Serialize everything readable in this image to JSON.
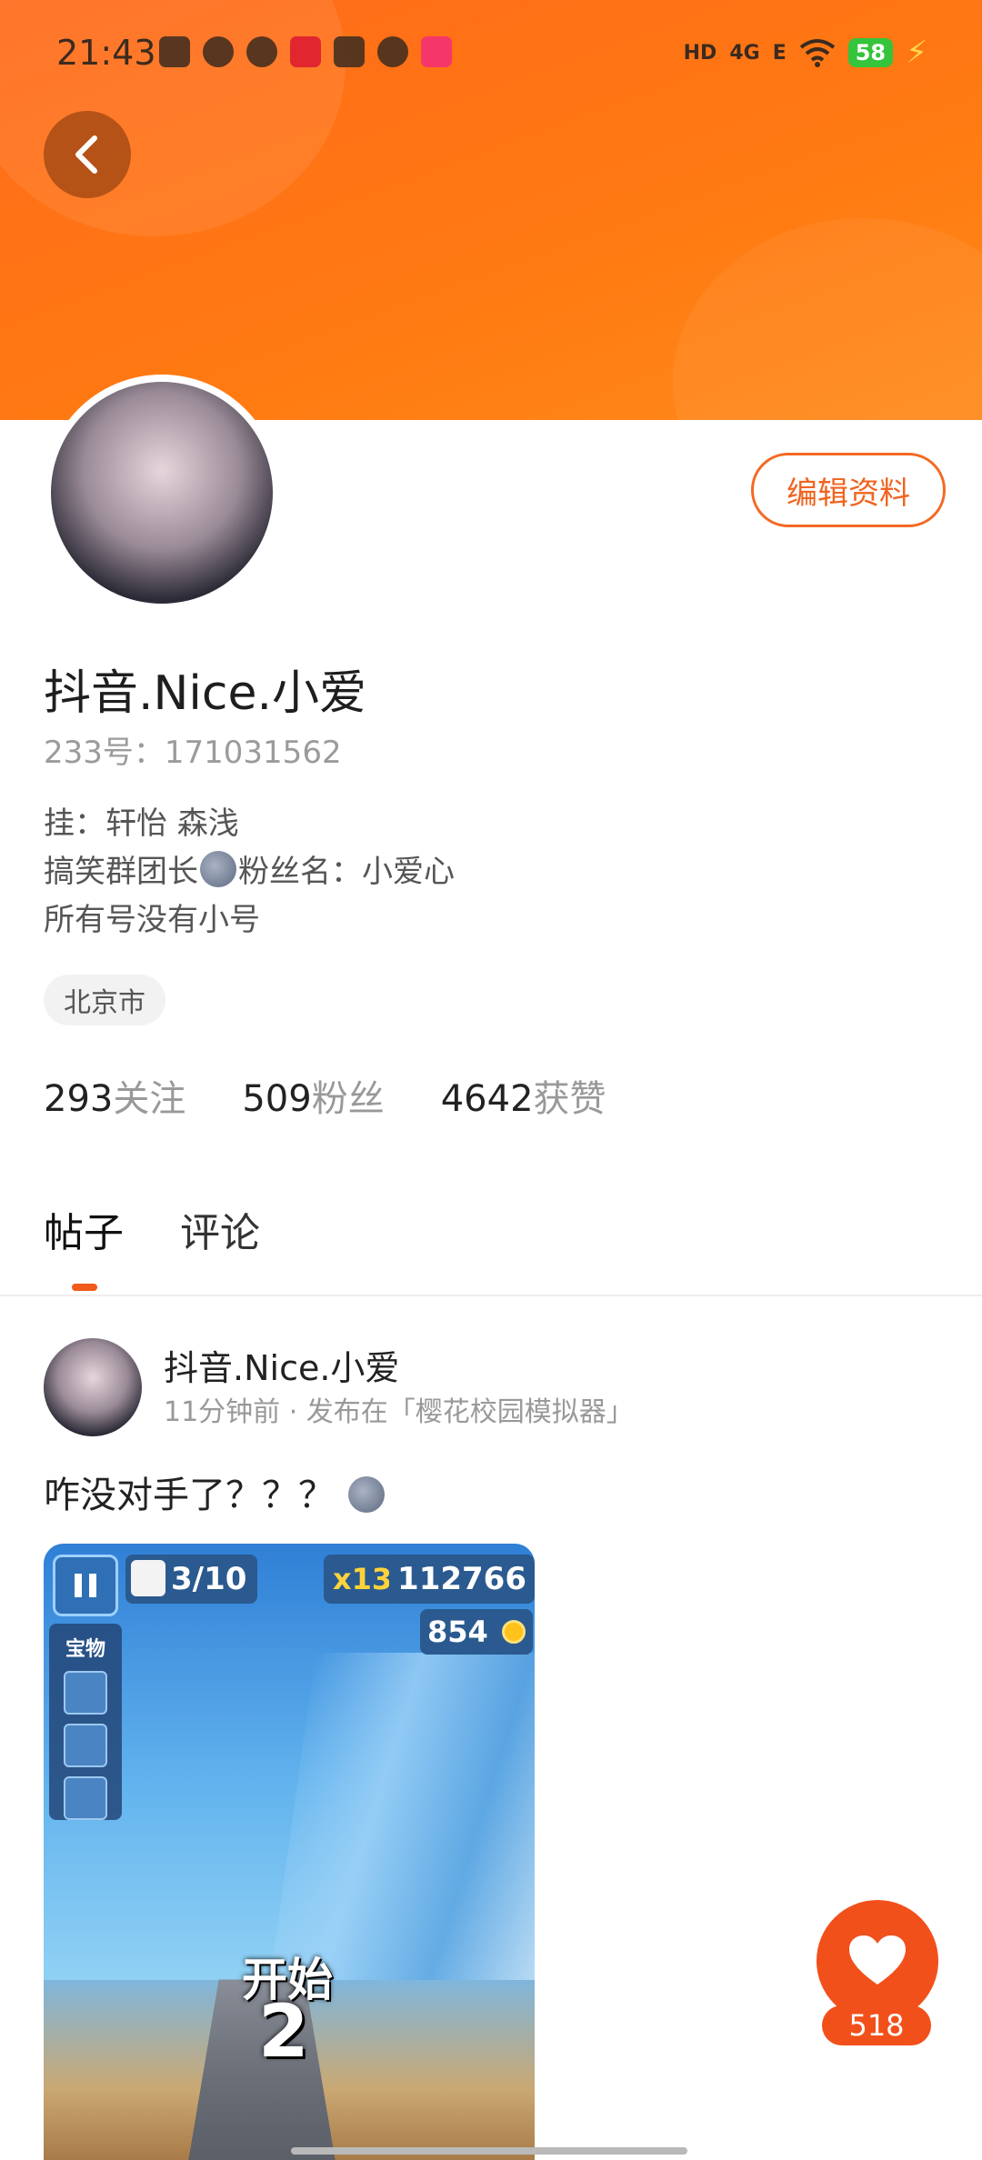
{
  "status_bar": {
    "time": "21:43",
    "network": "HD",
    "signal_4g": "4G",
    "signal_e": "E",
    "battery": "58"
  },
  "profile": {
    "name": "抖音.Nice.小爱",
    "id_text": "233号：171031562",
    "edit_label": "编辑资料",
    "bio_line1": "挂：轩怡 森浅",
    "bio_line2_a": "搞笑群团长",
    "bio_line2_b": "粉丝名：小爱心",
    "bio_line3": "所有号没有小号",
    "location": "北京市",
    "stats": {
      "following_count": "293",
      "following_label": "关注",
      "fans_count": "509",
      "fans_label": "粉丝",
      "likes_count": "4642",
      "likes_label": "获赞"
    }
  },
  "tabs": {
    "posts": "帖子",
    "comments": "评论"
  },
  "post": {
    "author": "抖音.Nice.小爱",
    "meta": "11分钟前 · 发布在「樱花校园模拟器」",
    "text": "咋没对手了？？？",
    "game": {
      "counter": "3/10",
      "multiplier": "x13",
      "score": "112766",
      "coins": "854",
      "treasure_label": "宝物",
      "start_text": "开始",
      "countdown": "2"
    }
  },
  "like": {
    "count": "518"
  }
}
